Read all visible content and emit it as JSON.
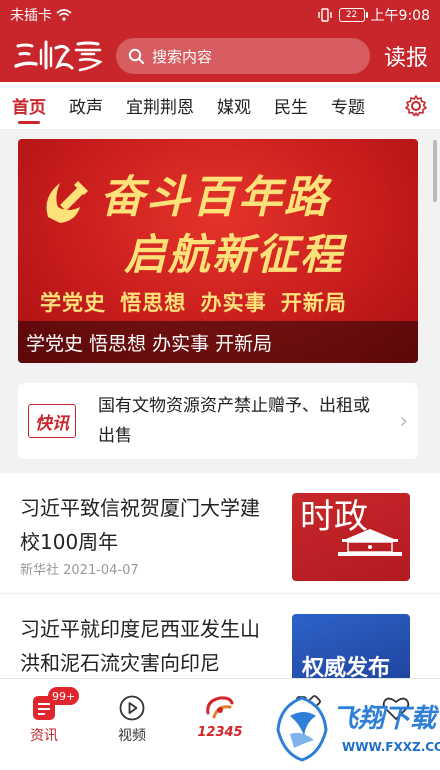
{
  "status_bar": {
    "carrier": "未插卡",
    "battery": "22",
    "time": "上午9:08"
  },
  "header": {
    "logo_text": "三峡云",
    "search_placeholder": "搜索内容",
    "read_button": "读报"
  },
  "tabs": [
    "首页",
    "政声",
    "宜荆荆恩",
    "媒观",
    "民生",
    "专题"
  ],
  "banner": {
    "line1": "奋斗百年路",
    "line2": "启航新征程",
    "slogan": "学党史 悟思想 办实事 开新局",
    "caption": "学党史 悟思想 办实事 开新局"
  },
  "flash": {
    "badge": "快讯",
    "text": "国有文物资源资产禁止赠予、出租或出售"
  },
  "news": [
    {
      "title": "习近平致信祝贺厦门大学建校100周年",
      "meta": "新华社 2021-04-07",
      "thumb_text": "时政"
    },
    {
      "title": "习近平就印度尼西亚发生山洪和泥石流灾害向印尼",
      "meta": "",
      "thumb_text": "权威发布"
    }
  ],
  "bottom_nav": [
    {
      "label": "资讯",
      "icon": "news-icon",
      "badge": "99+"
    },
    {
      "label": "视频",
      "icon": "video-icon"
    },
    {
      "label": "12345",
      "icon": "hotline-icon"
    },
    {
      "label": "",
      "icon": "services-icon"
    },
    {
      "label": "",
      "icon": "heart-icon"
    }
  ],
  "watermark": {
    "text1": "飞翔下载",
    "text2": "WWW.FXXZ.COM"
  },
  "colors": {
    "primary": "#c8262b",
    "banner_gold": "#ffe17a",
    "blue_thumb": "#2d62c9"
  }
}
